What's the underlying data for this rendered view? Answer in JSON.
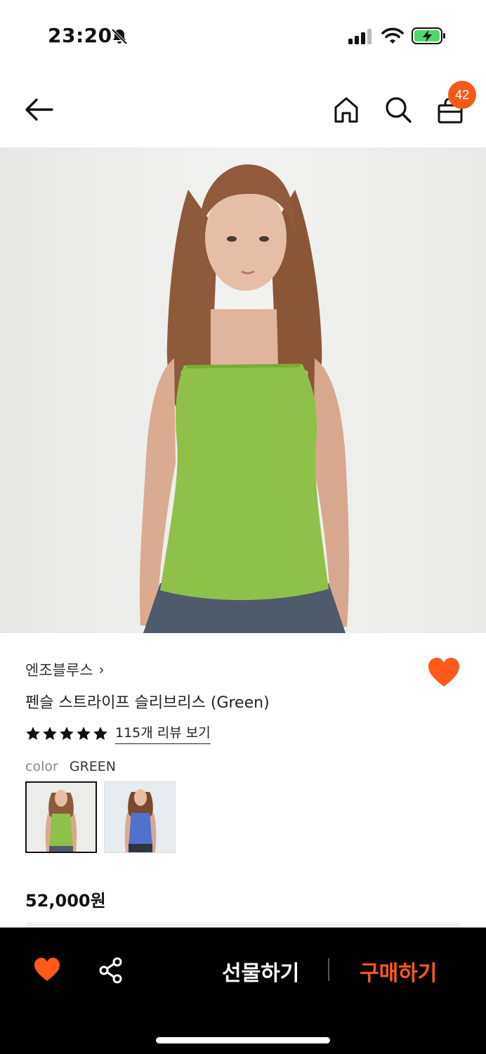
{
  "status_bar": {
    "time": "23:20",
    "icons": [
      "bell-slash-icon",
      "cellular-signal-icon",
      "wifi-icon",
      "battery-charging-icon"
    ]
  },
  "nav": {
    "icons": [
      "back-arrow-icon",
      "home-icon",
      "search-icon",
      "shopping-bag-icon"
    ],
    "cart_badge": "42"
  },
  "product": {
    "brand": "엔조블루스",
    "brand_chevron": "›",
    "title": "펜슬 스트라이프 슬리브리스 (Green)",
    "rating": 5,
    "review_link": "115개 리뷰 보기",
    "color_label": "color",
    "color_value": "GREEN",
    "swatches": [
      {
        "color": "green",
        "selected": true
      },
      {
        "color": "blue",
        "selected": false
      }
    ],
    "price": "52,000원",
    "wishlisted": true
  },
  "bottom_bar": {
    "gift_label": "선물하기",
    "buy_label": "구매하기",
    "icons": [
      "heart-icon",
      "share-icon"
    ]
  },
  "colors": {
    "accent": "#ff5a1a",
    "badge": "#f25a19",
    "top_green": "#8fc04a",
    "top_blue": "#4f73cc"
  }
}
